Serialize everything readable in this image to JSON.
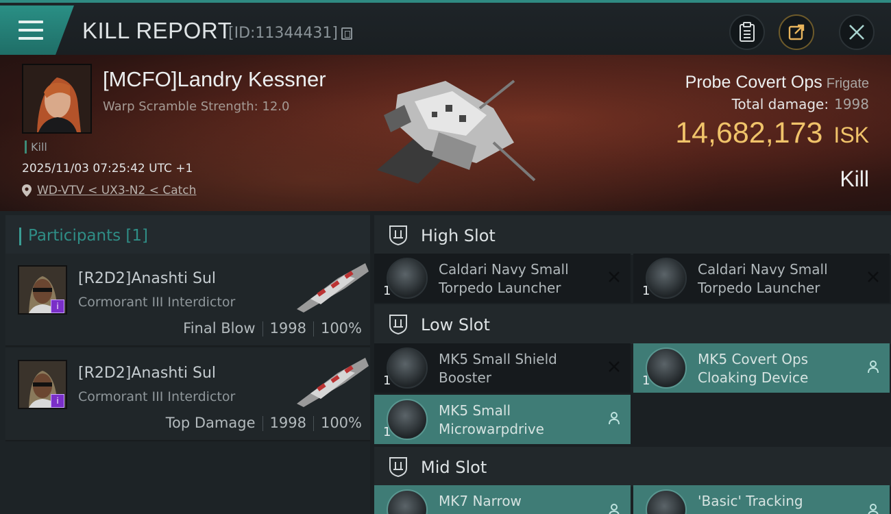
{
  "header": {
    "title": "KILL REPORT",
    "kill_id": "[ID:11344431]",
    "icons": [
      "menu-icon",
      "copy-icon",
      "clipboard-icon",
      "share-icon",
      "close-icon"
    ]
  },
  "victim": {
    "name": "[MCFO]Landry Kessner",
    "warp_scramble": "Warp Scramble Strength: 12.0",
    "tag": "Kill",
    "datetime": "2025/11/03 07:25:42 UTC +1",
    "location": "WD-VTV < UX3-N2 < Catch",
    "ship_name": "Probe Covert Ops",
    "ship_class": "Frigate",
    "total_damage_label": "Total damage:",
    "total_damage": "1998",
    "isk_value": "14,682,173",
    "isk_unit": "ISK",
    "result": "Kill"
  },
  "participants": {
    "title": "Participants [1]",
    "items": [
      {
        "name": "[R2D2]Anashti Sul",
        "ship": "Cormorant III Interdictor",
        "role": "Final Blow",
        "damage": "1998",
        "percent": "100%"
      },
      {
        "name": "[R2D2]Anashti Sul",
        "ship": "Cormorant III Interdictor",
        "role": "Top Damage",
        "damage": "1998",
        "percent": "100%"
      }
    ]
  },
  "slots": {
    "high": {
      "label": "High Slot",
      "modules": [
        {
          "name_line1": "Caldari Navy Small",
          "name_line2": "Torpedo Launcher",
          "qty": "1",
          "status": "destroyed"
        },
        {
          "name_line1": "Caldari Navy Small",
          "name_line2": "Torpedo Launcher",
          "qty": "1",
          "status": "destroyed"
        }
      ]
    },
    "low": {
      "label": "Low Slot",
      "modules": [
        {
          "name_line1": "MK5 Small Shield",
          "name_line2": "Booster",
          "qty": "1",
          "status": "destroyed"
        },
        {
          "name_line1": "MK5 Covert Ops",
          "name_line2": "Cloaking Device",
          "qty": "1",
          "status": "dropped"
        },
        {
          "name_line1": "MK5 Small",
          "name_line2": "Microwarpdrive",
          "qty": "1",
          "status": "dropped"
        }
      ]
    },
    "mid": {
      "label": "Mid Slot",
      "modules": [
        {
          "name_line1": "MK7 Narrow",
          "name_line2": "",
          "qty": "1",
          "status": "dropped"
        },
        {
          "name_line1": "'Basic' Tracking",
          "name_line2": "",
          "qty": "1",
          "status": "dropped"
        }
      ]
    }
  },
  "colors": {
    "accent_teal": "#2f8a82",
    "isk_gold": "#f0c36a",
    "fitted_module": "#3f7c76"
  }
}
